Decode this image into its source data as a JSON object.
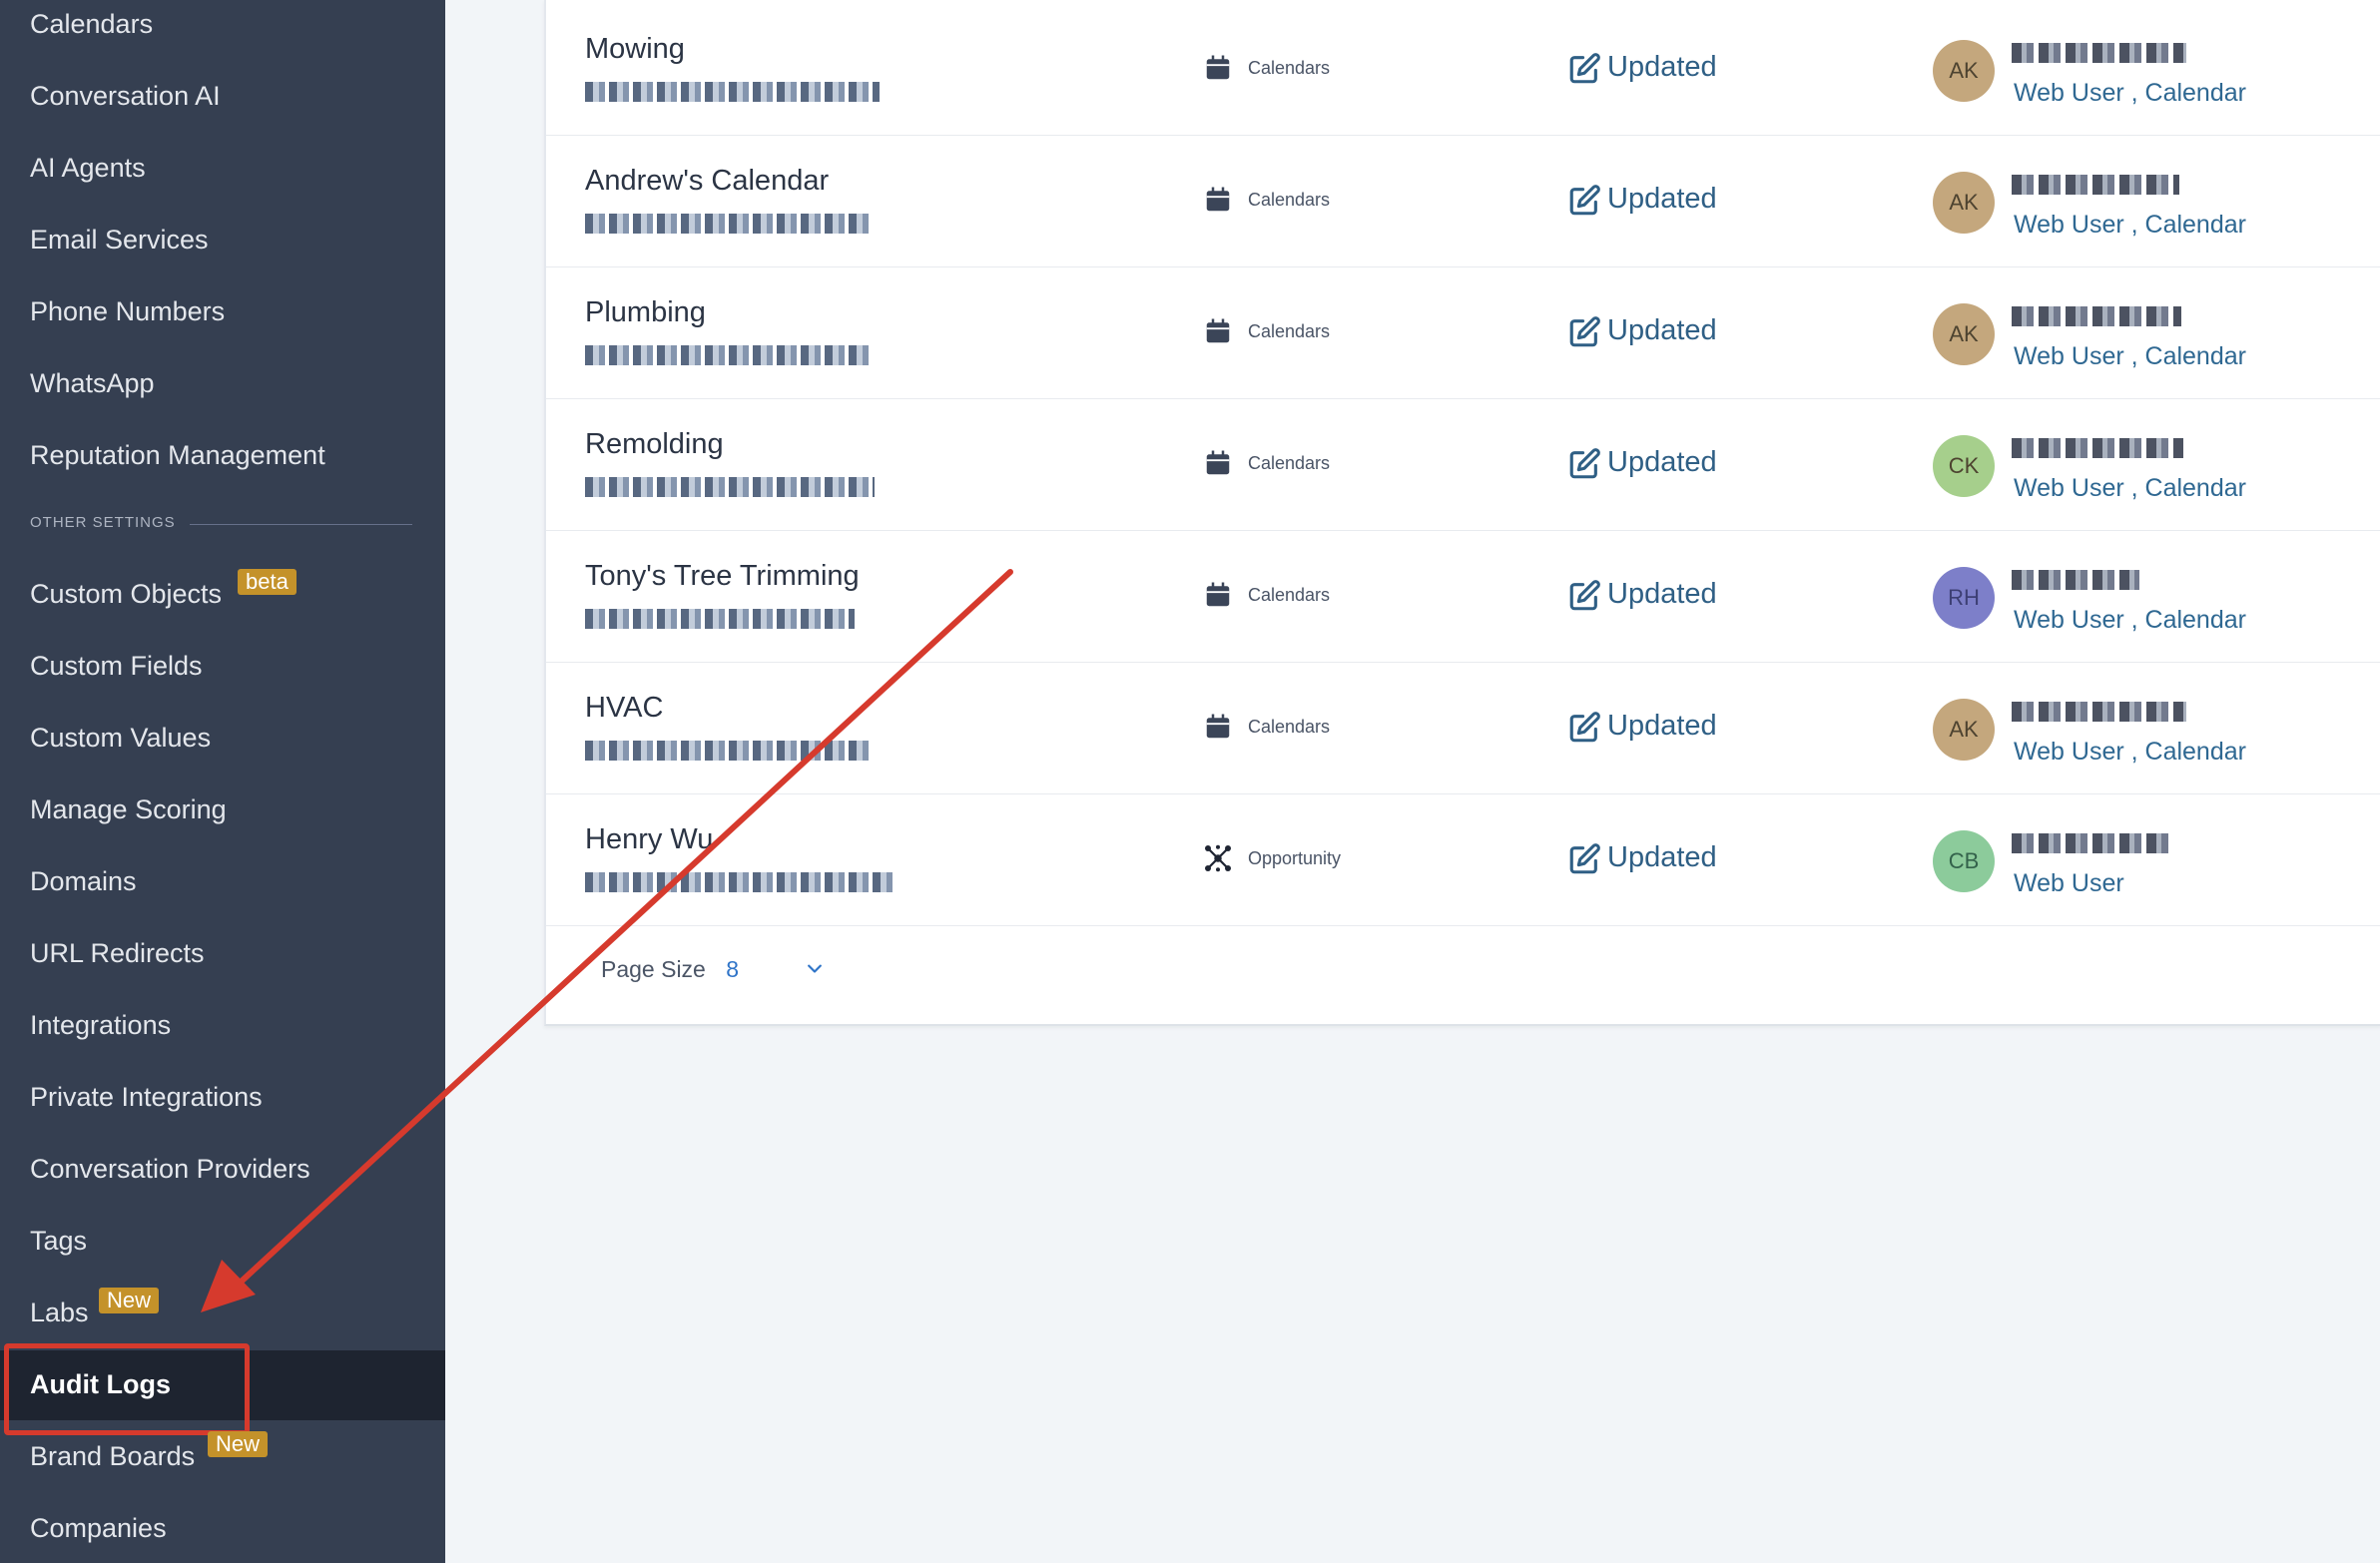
{
  "sidebar": {
    "items": [
      {
        "label": "Calendars"
      },
      {
        "label": "Conversation AI"
      },
      {
        "label": "AI Agents"
      },
      {
        "label": "Email Services"
      },
      {
        "label": "Phone Numbers"
      },
      {
        "label": "WhatsApp"
      },
      {
        "label": "Reputation Management"
      }
    ],
    "section_label": "OTHER SETTINGS",
    "other_items": [
      {
        "label": "Custom Objects",
        "badge": "beta"
      },
      {
        "label": "Custom Fields"
      },
      {
        "label": "Custom Values"
      },
      {
        "label": "Manage Scoring"
      },
      {
        "label": "Domains"
      },
      {
        "label": "URL Redirects"
      },
      {
        "label": "Integrations"
      },
      {
        "label": "Private Integrations"
      },
      {
        "label": "Conversation Providers"
      },
      {
        "label": "Tags"
      },
      {
        "label": "Labs",
        "badge": "New"
      },
      {
        "label": "Audit Logs",
        "active": true
      },
      {
        "label": "Brand Boards",
        "badge": "New"
      },
      {
        "label": "Companies"
      }
    ]
  },
  "table": {
    "rows": [
      {
        "name": "Mowing",
        "module": "Calendars",
        "action": "Updated",
        "initials": "AK",
        "source": "Web User , Calendar"
      },
      {
        "name": "Andrew's Calendar",
        "module": "Calendars",
        "action": "Updated",
        "initials": "AK",
        "source": "Web User , Calendar"
      },
      {
        "name": "Plumbing",
        "module": "Calendars",
        "action": "Updated",
        "initials": "AK",
        "source": "Web User , Calendar"
      },
      {
        "name": "Remolding",
        "module": "Calendars",
        "action": "Updated",
        "initials": "CK",
        "source": "Web User , Calendar"
      },
      {
        "name": "Tony's Tree Trimming",
        "module": "Calendars",
        "action": "Updated",
        "initials": "RH",
        "source": "Web User , Calendar"
      },
      {
        "name": "HVAC",
        "module": "Calendars",
        "action": "Updated",
        "initials": "AK",
        "source": "Web User , Calendar"
      },
      {
        "name": "Henry Wu",
        "module": "Opportunity",
        "action": "Updated",
        "initials": "CB",
        "source": "Web User"
      }
    ]
  },
  "pagination": {
    "label": "Page Size",
    "value": "8"
  },
  "colors": {
    "sidebar_bg": "#353f51",
    "active_bg": "#1e2430",
    "badge": "#c4922a",
    "highlight": "#d63a2d",
    "action_text": "#2f5f85",
    "avatar_ak": "#c4a77d",
    "avatar_ck": "#a6cf8c",
    "avatar_rh": "#7d7fc9",
    "avatar_cb": "#8ccb9b"
  },
  "icons": {
    "module_calendar": "calendar-icon",
    "module_opportunity": "opportunity-icon",
    "action": "edit-icon",
    "page_size": "chevron-down-icon"
  }
}
